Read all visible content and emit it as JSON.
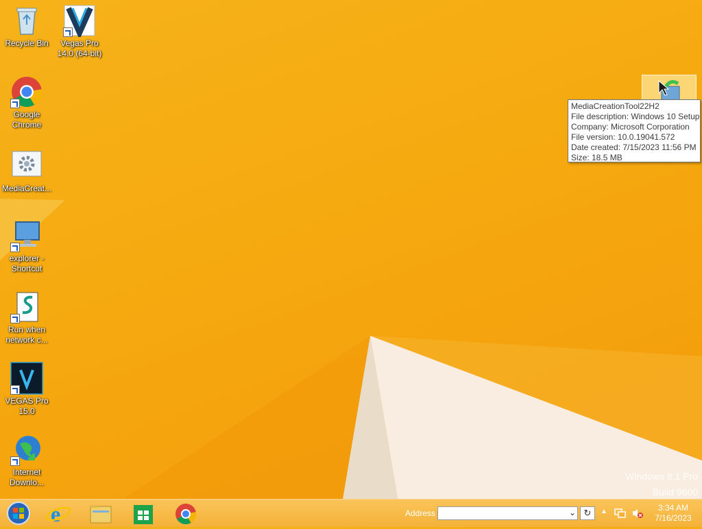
{
  "desktop": {
    "icons": [
      {
        "label": "Recycle Bin"
      },
      {
        "label": "Vegas Pro 14.0 (64-bit)"
      },
      {
        "label": "Google Chrome"
      },
      {
        "label": "MediaCreat..."
      },
      {
        "label": "explorer - Shortcut"
      },
      {
        "label": "Run when network c..."
      },
      {
        "label": "VEGAS Pro 15.0"
      },
      {
        "label": "Internet Downlo..."
      }
    ]
  },
  "tooltip": {
    "lines": [
      "MediaCreationTool22H2",
      "File description: Windows 10 Setup",
      "Company: Microsoft Corporation",
      "File version: 10.0.19041.572",
      "Date created: 7/15/2023 11:56 PM",
      "Size: 18.5 MB"
    ]
  },
  "watermark": {
    "edition": "Windows 8.1 Pro",
    "build": "Build 9600"
  },
  "taskbar": {
    "pinned": [
      "start-button",
      "internet-explorer",
      "file-explorer",
      "store",
      "chrome"
    ],
    "address_label": "Address",
    "address_value": "",
    "clock_time": "3:34 AM",
    "clock_date": "7/16/2023"
  },
  "colors": {
    "accent": "#f5a90f",
    "taskbar": "#f4b238"
  }
}
